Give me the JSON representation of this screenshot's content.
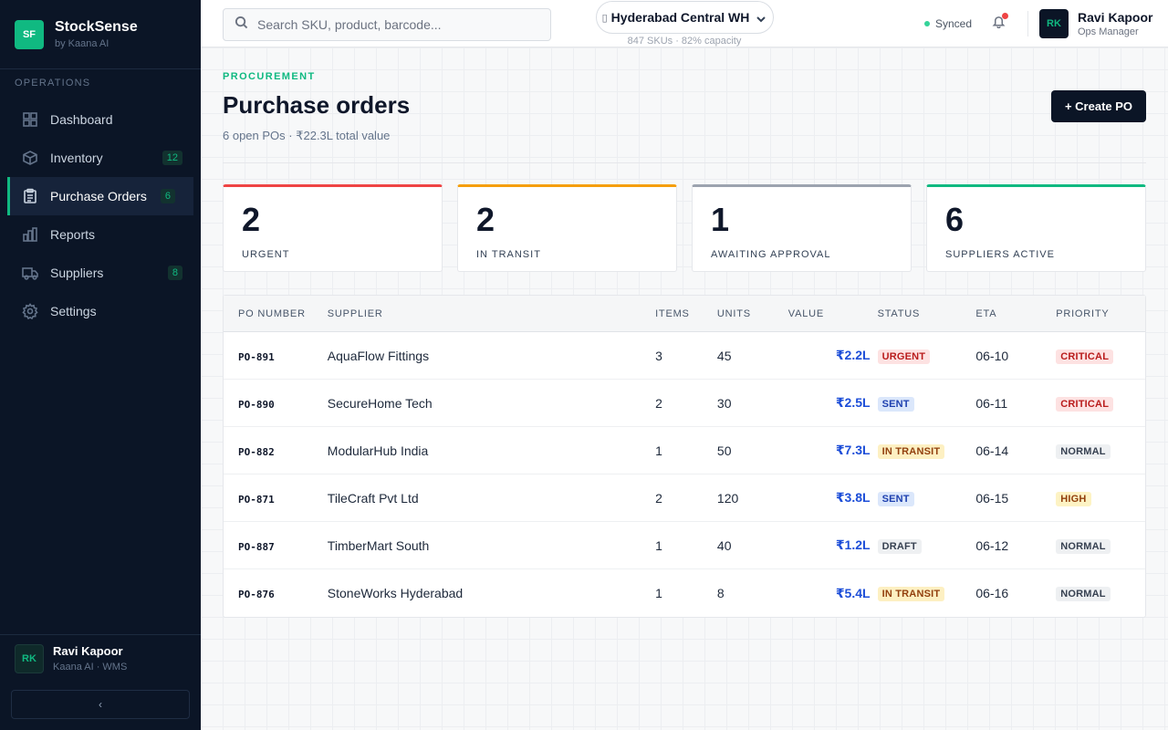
{
  "brand": {
    "logo": "SF",
    "name": "StockSense",
    "sub": "by Kaana AI"
  },
  "sidebar": {
    "section": "OPERATIONS",
    "items": [
      {
        "label": "Dashboard",
        "icon": "dashboard-icon",
        "badge": ""
      },
      {
        "label": "Inventory",
        "icon": "box-icon",
        "badge": "12"
      },
      {
        "label": "Purchase Orders",
        "icon": "clipboard-icon",
        "badge": "6",
        "active": true
      },
      {
        "label": "Reports",
        "icon": "bar-chart-icon",
        "badge": ""
      },
      {
        "label": "Suppliers",
        "icon": "truck-icon",
        "badge": "8"
      },
      {
        "label": "Settings",
        "icon": "gear-icon",
        "badge": ""
      }
    ],
    "user": {
      "initials": "RK",
      "name": "Ravi Kapoor",
      "sub": "Kaana AI · WMS"
    },
    "collapse_label": "‹"
  },
  "topbar": {
    "search_placeholder": "Search SKU, product, barcode...",
    "warehouse": "Hyderabad Central WH",
    "warehouse_meta": "847 SKUs · 82% capacity",
    "sync_status": "Synced",
    "user": {
      "initials": "RK",
      "name": "Ravi Kapoor",
      "role": "Ops Manager"
    }
  },
  "page": {
    "eyebrow": "PROCUREMENT",
    "title": "Purchase orders",
    "subtitle": "6 open POs · ₹22.3L total value",
    "create_label": "+ Create PO"
  },
  "stats": [
    {
      "value": "2",
      "label": "URGENT",
      "color": "#ef4444"
    },
    {
      "value": "2",
      "label": "IN TRANSIT",
      "color": "#f59e0b"
    },
    {
      "value": "1",
      "label": "AWAITING APPROVAL",
      "color": "#9ca3af"
    },
    {
      "value": "6",
      "label": "SUPPLIERS ACTIVE",
      "color": "#10b981"
    }
  ],
  "table": {
    "columns": [
      "PO NUMBER",
      "SUPPLIER",
      "ITEMS",
      "UNITS",
      "VALUE",
      "STATUS",
      "ETA",
      "PRIORITY"
    ],
    "rows": [
      {
        "po": "PO-891",
        "supplier": "AquaFlow Fittings",
        "items": "3",
        "units": "45",
        "value": "₹2.2L",
        "status": "URGENT",
        "eta": "06-10",
        "priority": "CRITICAL"
      },
      {
        "po": "PO-890",
        "supplier": "SecureHome Tech",
        "items": "2",
        "units": "30",
        "value": "₹2.5L",
        "status": "SENT",
        "eta": "06-11",
        "priority": "CRITICAL"
      },
      {
        "po": "PO-882",
        "supplier": "ModularHub India",
        "items": "1",
        "units": "50",
        "value": "₹7.3L",
        "status": "IN TRANSIT",
        "eta": "06-14",
        "priority": "NORMAL"
      },
      {
        "po": "PO-871",
        "supplier": "TileCraft Pvt Ltd",
        "items": "2",
        "units": "120",
        "value": "₹3.8L",
        "status": "SENT",
        "eta": "06-15",
        "priority": "HIGH"
      },
      {
        "po": "PO-887",
        "supplier": "TimberMart South",
        "items": "1",
        "units": "40",
        "value": "₹1.2L",
        "status": "DRAFT",
        "eta": "06-12",
        "priority": "NORMAL"
      },
      {
        "po": "PO-876",
        "supplier": "StoneWorks Hyderabad",
        "items": "1",
        "units": "8",
        "value": "₹5.4L",
        "status": "IN TRANSIT",
        "eta": "06-16",
        "priority": "NORMAL"
      }
    ]
  },
  "pill_colors": {
    "URGENT": {
      "bg": "#fde2e2",
      "fg": "#b91c1c"
    },
    "SENT": {
      "bg": "#dbe7fb",
      "fg": "#1e40af"
    },
    "IN TRANSIT": {
      "bg": "#fdf0c2",
      "fg": "#92400e"
    },
    "DRAFT": {
      "bg": "#eef0f2",
      "fg": "#374151"
    },
    "CRITICAL": {
      "bg": "#fde2e2",
      "fg": "#b91c1c"
    },
    "HIGH": {
      "bg": "#fdf3c4",
      "fg": "#92400e"
    },
    "NORMAL": {
      "bg": "#eef0f2",
      "fg": "#374151"
    }
  }
}
